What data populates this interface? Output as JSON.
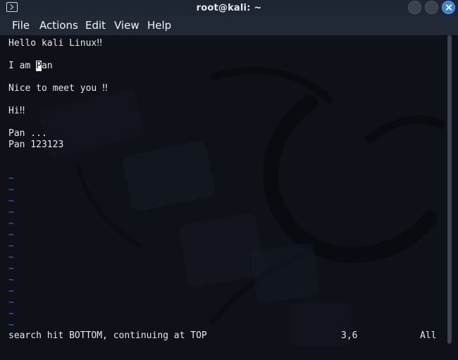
{
  "window": {
    "title": "root@kali: ~"
  },
  "menu": {
    "file": "File",
    "actions": "Actions",
    "edit": "Edit",
    "view": "View",
    "help": "Help"
  },
  "editor": {
    "line1": "Hello kali Linux‼",
    "line2_pre": "I am ",
    "line2_cursor": "P",
    "line2_post": "an",
    "line3": "Nice to meet you ‼",
    "line4": "Hi‼",
    "line5": "Pan ...",
    "line6": "Pan 123123",
    "tilde": "~"
  },
  "status": {
    "message": "search hit BOTTOM, continuing at TOP",
    "position": "3,6",
    "scroll": "All"
  },
  "colors": {
    "background": "#0e1118",
    "text": "#e6e8ec",
    "tilde": "#3d66d6",
    "close_button": "#3a84d8"
  }
}
